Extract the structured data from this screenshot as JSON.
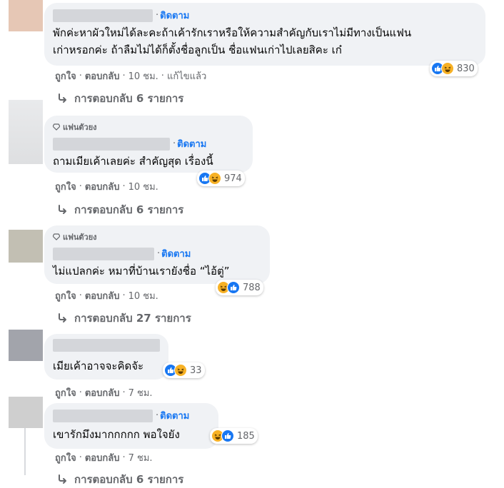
{
  "colors": {
    "accent": "#1877f2",
    "bubble": "#f0f2f5",
    "muted": "#65676b",
    "haha": "#f7b125"
  },
  "comments": [
    {
      "follow": "ติดตาม",
      "text_lines": [
        "พักค่ะหาผัวใหม่ได้ละคะถ้าเค้ารักเราหรือให้ความสำคัญกับเราไม่มีทางเป็นแฟน",
        "เก่าหรอกค่ะ ถ้าลืมไม่ได้ก็ตั้งชื่อลูกเป็น ชื่อแฟนเก่าไปเลยสิคะ เก๋"
      ],
      "reaction_count": "830",
      "like": "ถูกใจ",
      "reply": "ตอบกลับ",
      "time": "10 ชม.",
      "edited": "แก้ไขแล้ว",
      "replies": "การตอบกลับ 6 รายการ"
    },
    {
      "badge": "แฟนตัวยง",
      "follow": "ติดตาม",
      "text_lines": [
        "ถามเมียเค้าเลยค่ะ สำคัญสุด เรื่องนี้"
      ],
      "reaction_count": "974",
      "like": "ถูกใจ",
      "reply": "ตอบกลับ",
      "time": "10 ชม.",
      "replies": "การตอบกลับ 6 รายการ"
    },
    {
      "badge": "แฟนตัวยง",
      "follow": "ติดตาม",
      "text_lines": [
        "ไม่แปลกค่ะ หมาที่บ้านเรายังชื่อ “ไอ้ตู่”"
      ],
      "reaction_count": "788",
      "like": "ถูกใจ",
      "reply": "ตอบกลับ",
      "time": "10 ชม.",
      "replies": "การตอบกลับ 27 รายการ"
    },
    {
      "text_lines": [
        "เมียเค้าอาจจะคิดจัะ"
      ],
      "reaction_count": "33",
      "like": "ถูกใจ",
      "reply": "ตอบกลับ",
      "time": "7 ชม."
    },
    {
      "follow": "ติดตาม",
      "text_lines": [
        "เขารักมึงมากกกกก พอใจยัง"
      ],
      "reaction_count": "185",
      "like": "ถูกใจ",
      "reply": "ตอบกลับ",
      "time": "7 ชม.",
      "replies": "การตอบกลับ 6 รายการ"
    }
  ],
  "icons": {
    "like": "like-icon",
    "haha": "haha-icon",
    "reply_arrow": "reply-arrow-icon",
    "fan": "diamond-icon"
  }
}
